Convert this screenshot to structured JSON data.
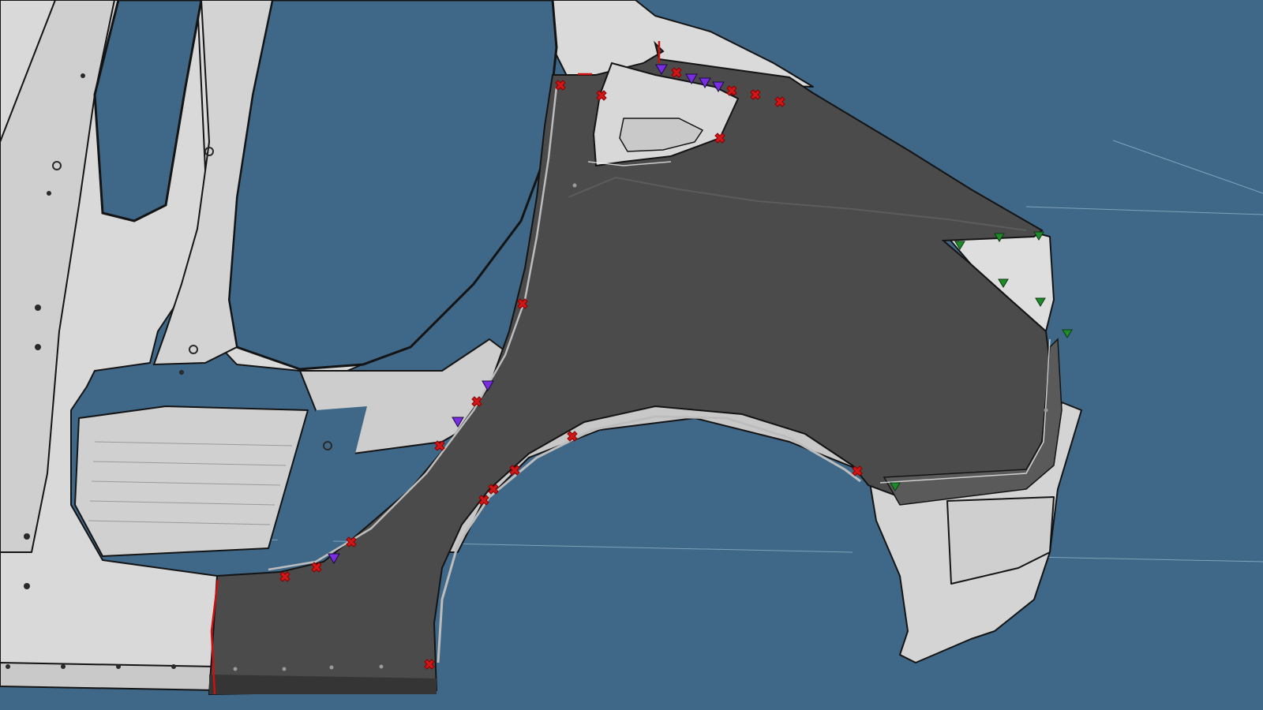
{
  "scene": {
    "background_color": "#3f6888",
    "grid_line_color": "#8fb0c8",
    "body_panel_color": "#d7d7d7",
    "body_edge_color": "#141414",
    "selected_panel_color": "#4b4b4b",
    "seam_color": "#cc1111"
  },
  "markers": {
    "weld_point": {
      "icon": "red-cross-icon",
      "color": "#d01818"
    },
    "locator_point": {
      "icon": "purple-triangle-icon",
      "color": "#7a2de0"
    },
    "datum_point": {
      "icon": "green-triangle-icon",
      "color": "#1f8a2a"
    }
  }
}
